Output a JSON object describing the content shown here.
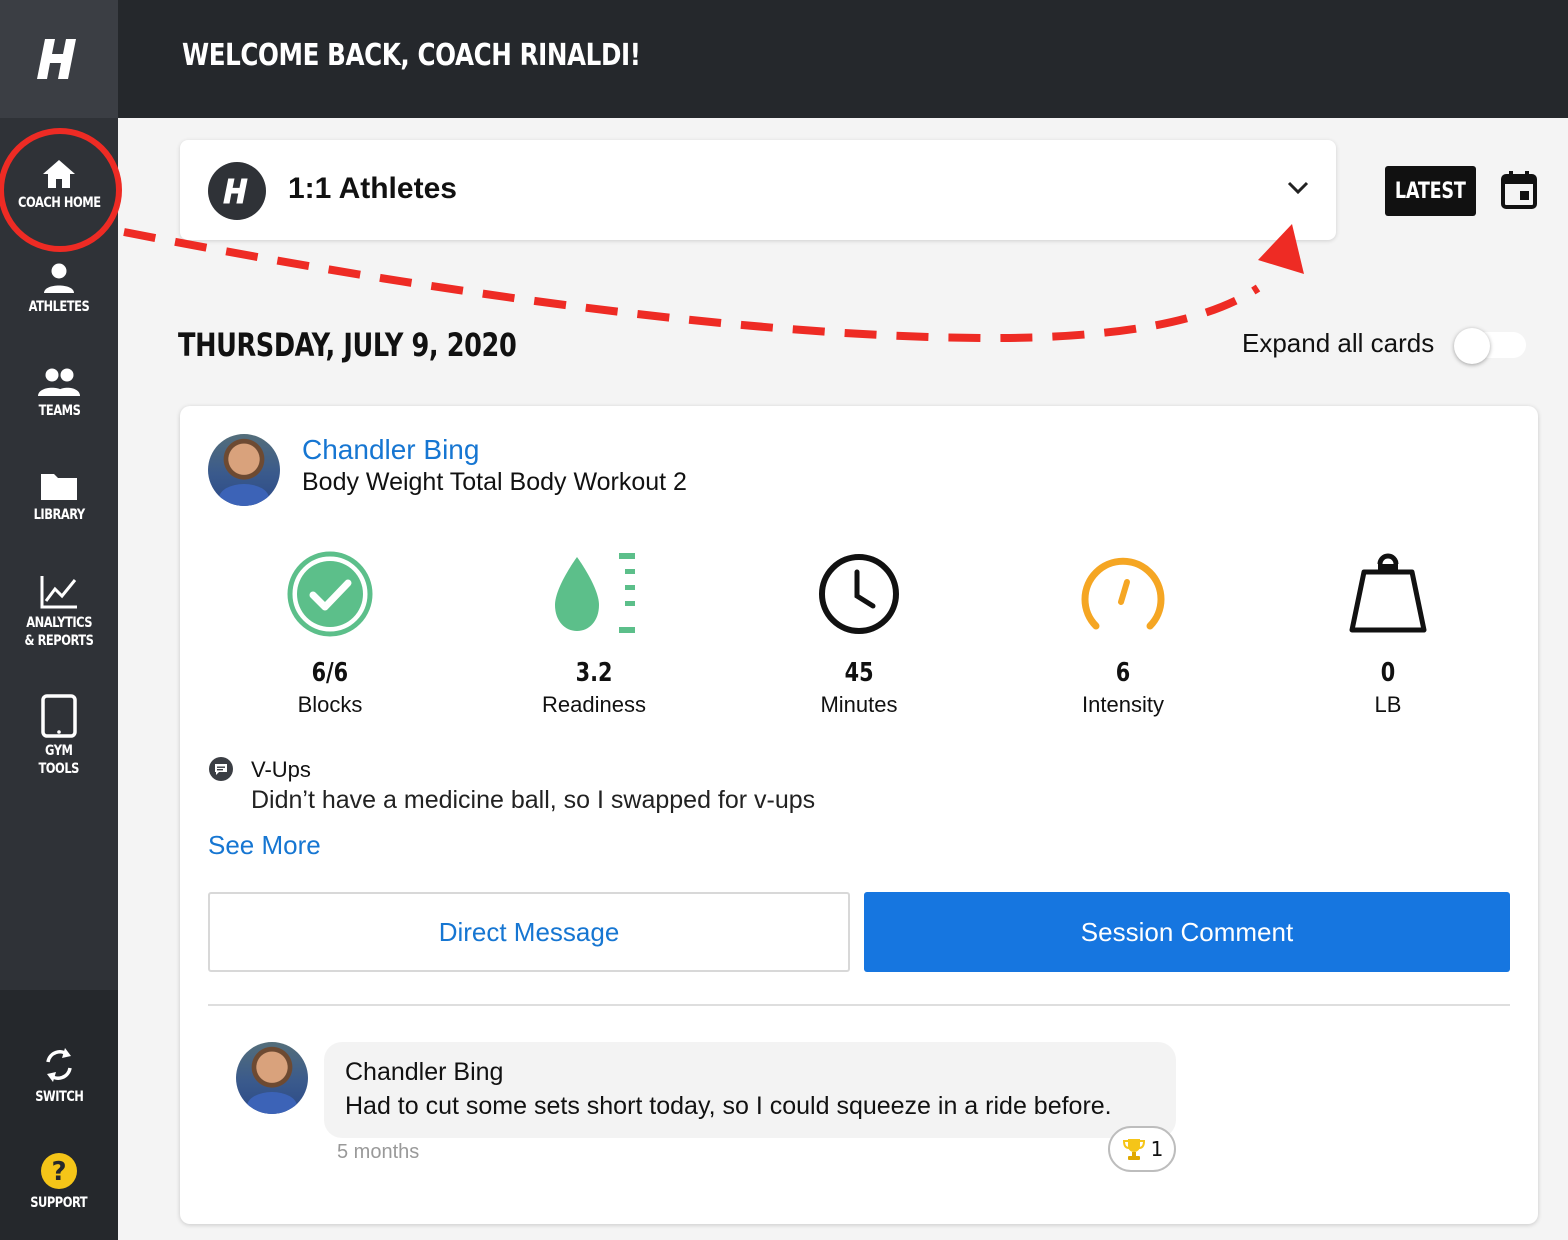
{
  "header": {
    "title": "WELCOME BACK, COACH RINALDI!"
  },
  "sidebar": {
    "items": [
      {
        "label": "COACH HOME",
        "icon": "home-icon"
      },
      {
        "label": "ATHLETES",
        "icon": "person-icon"
      },
      {
        "label": "TEAMS",
        "icon": "group-icon"
      },
      {
        "label": "LIBRARY",
        "icon": "folder-icon"
      },
      {
        "label_line1": "ANALYTICS",
        "label_line2": "& REPORTS",
        "icon": "chart-icon"
      },
      {
        "label_line1": "GYM",
        "label_line2": "TOOLS",
        "icon": "tablet-icon"
      }
    ],
    "switch_label": "SWITCH",
    "support_label": "SUPPORT"
  },
  "selector": {
    "label": "1:1 Athletes"
  },
  "latest_label": "LATEST",
  "date_heading": "THURSDAY, JULY 9, 2020",
  "expand_all": {
    "label": "Expand all cards",
    "on": false
  },
  "card": {
    "athlete_name": "Chandler Bing",
    "workout_name": "Body Weight Total Body Workout 2",
    "stats": [
      {
        "value": "6/6",
        "label": "Blocks",
        "icon": "check-circle-icon",
        "color": "#5cbf8a"
      },
      {
        "value": "3.2",
        "label": "Readiness",
        "icon": "readiness-drop-icon",
        "color": "#5cbf8a"
      },
      {
        "value": "45",
        "label": "Minutes",
        "icon": "clock-icon",
        "color": "#111111"
      },
      {
        "value": "6",
        "label": "Intensity",
        "icon": "gauge-icon",
        "color": "#f5a623"
      },
      {
        "value": "0",
        "label": "LB",
        "icon": "weight-icon",
        "color": "#111111"
      }
    ],
    "note": {
      "title": "V-Ups",
      "text": "Didn’t have a medicine ball, so I swapped for v-ups"
    },
    "see_more": "See More",
    "direct_message": "Direct Message",
    "session_comment": "Session Comment",
    "comment": {
      "author": "Chandler  Bing",
      "text": "Had to cut some sets short today, so I could squeeze in a ride before.",
      "time": "5 months",
      "reaction_count": "1"
    }
  },
  "colors": {
    "accent": "#1676e0",
    "annotation": "#ee2b24",
    "sidebar": "#2f3237",
    "header": "#25282c"
  }
}
